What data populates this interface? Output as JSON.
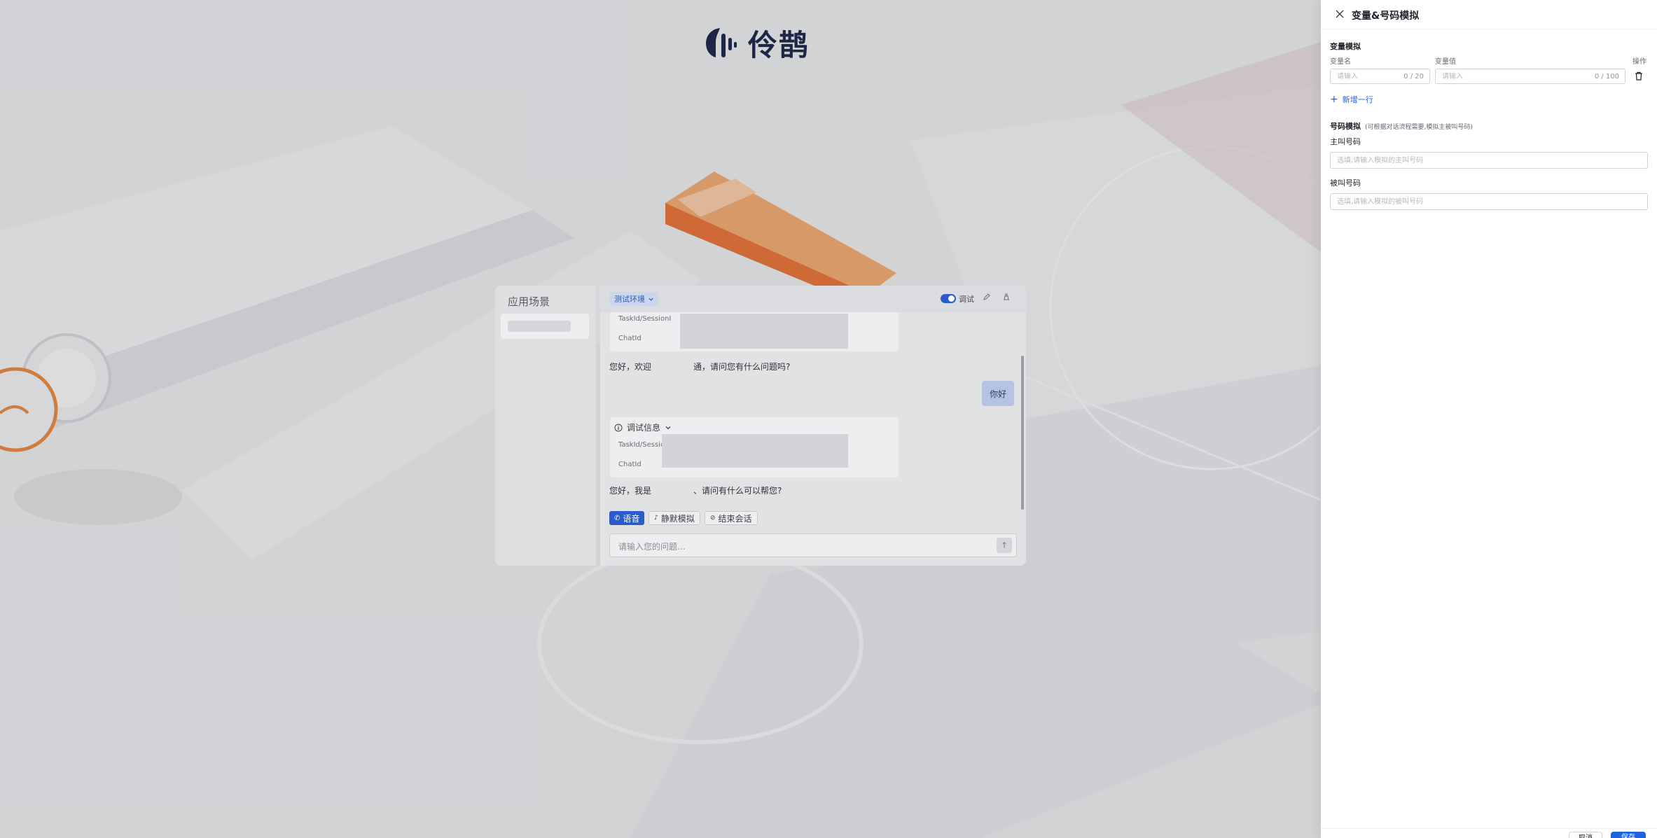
{
  "app": {
    "logo_text": "伶鹊"
  },
  "scene_panel": {
    "title": "应用场景"
  },
  "chat": {
    "env_label": "测试环境",
    "debug_toggle_label": "调试",
    "debug_card_1": {
      "row1": "TaskId/SessionI",
      "row2": "ChatId"
    },
    "message_1": "您好，欢迎　　　　　通，请问您有什么问题吗?",
    "user_message": "你好",
    "debug_card_2": {
      "title": "调试信息",
      "row1": "TaskId/Sessic",
      "row2": "ChatId"
    },
    "message_2": "您好，我是　　　　　、请问有什么可以帮您?",
    "actions": {
      "voice": "语音",
      "silence": "静默模拟",
      "end": "结束会话"
    },
    "input_placeholder": "请输入您的问题..."
  },
  "drawer": {
    "title": "变量&号码模拟",
    "variables": {
      "section_title": "变量模拟",
      "col_name": "变量名",
      "col_value": "变量值",
      "col_action": "操作",
      "rows": [
        {
          "name_placeholder": "请输入",
          "name_counter": "0 / 20",
          "value_placeholder": "请输入",
          "value_counter": "0 / 100"
        }
      ],
      "add_row_label": "新增一行"
    },
    "numbers": {
      "section_title": "号码模拟",
      "hint": "(可根据对话流程需要,模拟主被叫号码)",
      "caller_label": "主叫号码",
      "caller_placeholder": "选填,请输入模拟的主叫号码",
      "callee_label": "被叫号码",
      "callee_placeholder": "选填,请输入模拟的被叫号码"
    },
    "footer": {
      "cancel_label": "取消",
      "ok_label": "保存"
    }
  },
  "colors": {
    "primary": "#1f62e0",
    "accent_orange": "#f07a2a",
    "logo_navy": "#1d2745"
  }
}
